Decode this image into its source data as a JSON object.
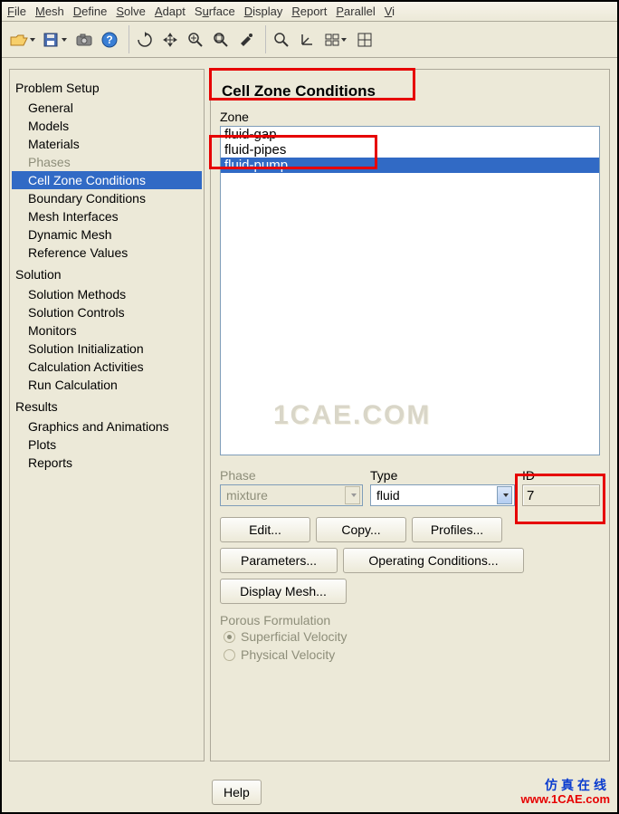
{
  "menu": {
    "items": [
      "File",
      "Mesh",
      "Define",
      "Solve",
      "Adapt",
      "Surface",
      "Display",
      "Report",
      "Parallel",
      "Vi"
    ]
  },
  "tree": {
    "sections": [
      {
        "title": "Problem Setup",
        "items": [
          {
            "label": "General",
            "disabled": false,
            "selected": false
          },
          {
            "label": "Models",
            "disabled": false,
            "selected": false
          },
          {
            "label": "Materials",
            "disabled": false,
            "selected": false
          },
          {
            "label": "Phases",
            "disabled": true,
            "selected": false
          },
          {
            "label": "Cell Zone Conditions",
            "disabled": false,
            "selected": true
          },
          {
            "label": "Boundary Conditions",
            "disabled": false,
            "selected": false
          },
          {
            "label": "Mesh Interfaces",
            "disabled": false,
            "selected": false
          },
          {
            "label": "Dynamic Mesh",
            "disabled": false,
            "selected": false
          },
          {
            "label": "Reference Values",
            "disabled": false,
            "selected": false
          }
        ]
      },
      {
        "title": "Solution",
        "items": [
          {
            "label": "Solution Methods"
          },
          {
            "label": "Solution Controls"
          },
          {
            "label": "Monitors"
          },
          {
            "label": "Solution Initialization"
          },
          {
            "label": "Calculation Activities"
          },
          {
            "label": "Run Calculation"
          }
        ]
      },
      {
        "title": "Results",
        "items": [
          {
            "label": "Graphics and Animations"
          },
          {
            "label": "Plots"
          },
          {
            "label": "Reports"
          }
        ]
      }
    ]
  },
  "panel": {
    "title": "Cell Zone Conditions",
    "zone_label": "Zone",
    "zones": [
      {
        "label": "fluid-gap",
        "selected": false
      },
      {
        "label": "fluid-pipes",
        "selected": false
      },
      {
        "label": "fluid-pump",
        "selected": true
      }
    ],
    "phase": {
      "label": "Phase",
      "value": "mixture",
      "disabled": true
    },
    "type": {
      "label": "Type",
      "value": "fluid"
    },
    "id": {
      "label": "ID",
      "value": "7"
    },
    "buttons": {
      "edit": "Edit...",
      "copy": "Copy...",
      "profiles": "Profiles...",
      "parameters": "Parameters...",
      "operating": "Operating Conditions...",
      "displaymesh": "Display Mesh..."
    },
    "porous": {
      "label": "Porous Formulation",
      "options": [
        "Superficial Velocity",
        "Physical Velocity"
      ],
      "selected": 0
    },
    "help": "Help"
  },
  "watermark": "1CAE.COM",
  "corner": {
    "cn": "仿真在线",
    "url": "www.1CAE.com"
  }
}
